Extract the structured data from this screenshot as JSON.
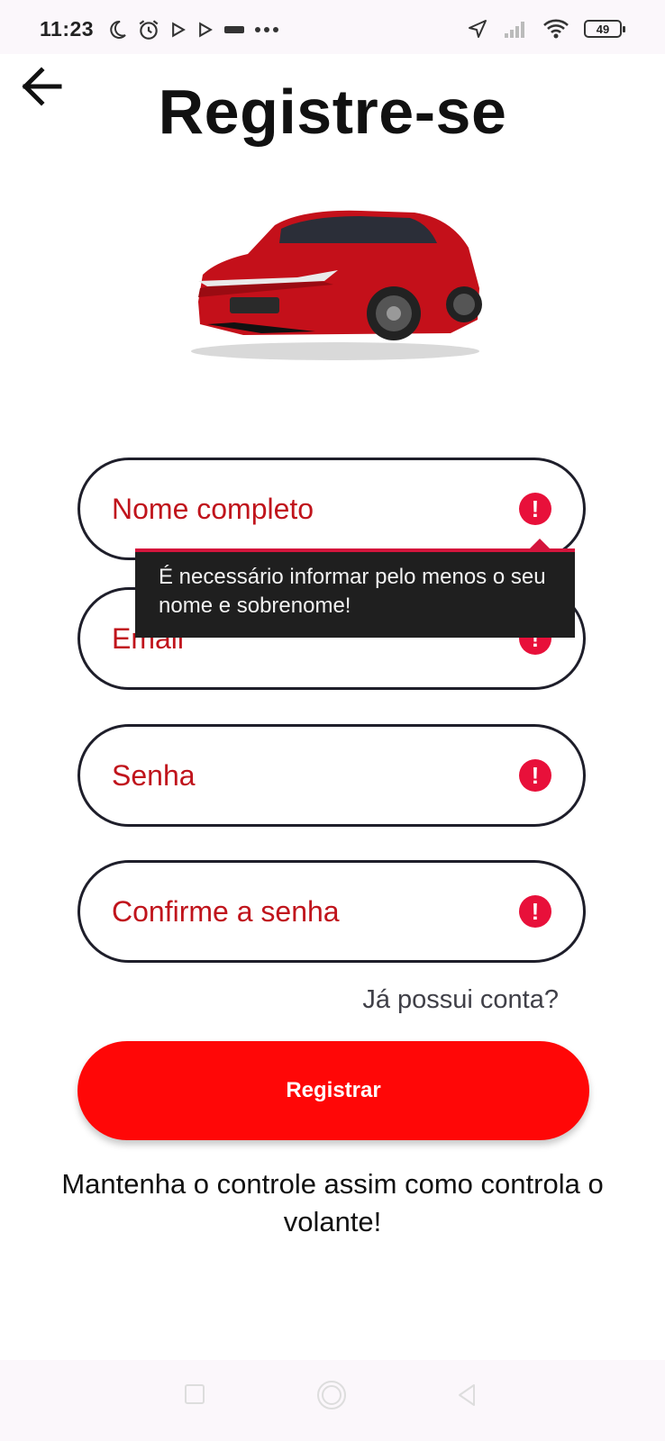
{
  "status_bar": {
    "time": "11:23",
    "left_icons": [
      "moon-icon",
      "alarm-icon",
      "play-store-icon",
      "play-store-icon",
      "app-icon",
      "more-dots-icon"
    ],
    "right_icons": [
      "location-arrow-icon",
      "signal-icon",
      "wifi-icon",
      "battery-icon"
    ],
    "battery_level": "49"
  },
  "header": {
    "back_icon": "arrow-left-icon",
    "title": "Registre-se"
  },
  "hero_image": {
    "description_icon": "red-car-image"
  },
  "form": {
    "fields": [
      {
        "label": "Nome completo",
        "error_icon": "error-icon"
      },
      {
        "label": "Email",
        "error_icon": "error-icon"
      },
      {
        "label": "Senha",
        "error_icon": "error-icon"
      },
      {
        "label": "Confirme a senha",
        "error_icon": "error-icon"
      }
    ],
    "error_tooltip": "É necessário informar pelo menos o seu nome e sobrenome!",
    "login_link": "Já possui conta?",
    "submit_label": "Registrar"
  },
  "tagline": "Mantenha o controle assim como controla o volante!",
  "colors": {
    "accent": "#ff0707",
    "error": "#e8103a",
    "label": "#c0141c",
    "tooltip_bg": "#1f1f1f"
  },
  "nav_bar": {
    "buttons": [
      "square-icon",
      "circle-icon",
      "back-triangle-icon"
    ]
  }
}
